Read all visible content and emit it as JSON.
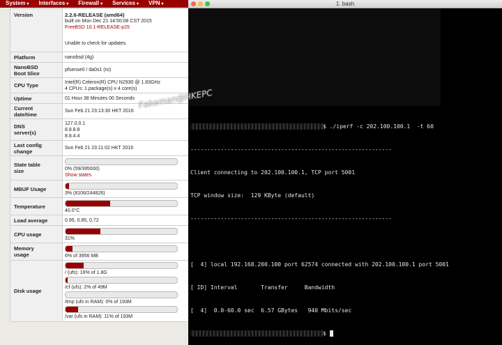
{
  "nav": {
    "items": [
      {
        "label": "System",
        "dd": "▾"
      },
      {
        "label": "Interfaces",
        "dd": "▾"
      },
      {
        "label": "Firewall",
        "dd": "▾"
      },
      {
        "label": "Services",
        "dd": "▾"
      },
      {
        "label": "VPN",
        "dd": "▾"
      }
    ]
  },
  "sysinfo": {
    "version": {
      "label": "Version",
      "line1": "2.2.6-RELEASE (amd64)",
      "line2": "built on Mon Dec 21 14:50:08 CST 2015",
      "line3": "FreeBSD 10.1-RELEASE-p25",
      "line4": "Unable to check for updates."
    },
    "platform": {
      "label": "Platform",
      "value": "nanobsd (4g)"
    },
    "bootslice": {
      "label1": "NanoBSD",
      "label2": "Boot Slice",
      "value": "pfsense0 / da0s1 (ro)"
    },
    "cpu_type": {
      "label": "CPU Type",
      "line1": "Intel(R) Celeron(R) CPU N2930 @ 1.83GHz",
      "line2": "4 CPUs: 1 package(s) x 4 core(s)"
    },
    "uptime": {
      "label": "Uptime",
      "value": "01 Hour 38 Minutes 00 Seconds"
    },
    "current": {
      "label1": "Current",
      "label2": "date/time",
      "value": "Sun Feb 21 23:13:30 HKT 2016"
    },
    "dns": {
      "label1": "DNS",
      "label2": "server(s)",
      "servers": [
        "127.0.0.1",
        "8.8.8.8",
        "8.8.4.4"
      ]
    },
    "lastconfig": {
      "label1": "Last config",
      "label2": "change",
      "value": "Sun Feb 21 23:11:02 HKT 2016"
    },
    "statetable": {
      "label1": "State table",
      "label2": "size",
      "value": "0% (59/395000)",
      "link": "Show states",
      "fraction": 0.0
    },
    "mbuf": {
      "label": "MBUF Usage",
      "value": "3% (8106/244826)",
      "fraction": 0.03
    },
    "temperature": {
      "label": "Temperature",
      "value": "40.0°C",
      "fraction": 0.4
    },
    "loadavg": {
      "label": "Load average",
      "value": "0.95, 0.85, 0.72"
    },
    "cpuusage": {
      "label": "CPU usage",
      "value": "31%",
      "fraction": 0.31
    },
    "memory": {
      "label1": "Memory",
      "label2": "usage",
      "value": "6% of 3956 MB",
      "fraction": 0.06
    },
    "disk": {
      "label": "Disk usage",
      "items": [
        {
          "text": "/ (ufs): 16% of 1.8G",
          "fraction": 0.16
        },
        {
          "text": "/cf (ufs): 2% of 49M",
          "fraction": 0.02
        },
        {
          "text": "/tmp (ufs in RAM): 0% of 193M",
          "fraction": 0.0
        },
        {
          "text": "/var (ufs in RAM): 11% of 193M",
          "fraction": 0.11
        }
      ]
    }
  },
  "terminal": {
    "title": "1. bash",
    "lines": {
      "cmd": "$ ./iperf -c 202.100.100.1  -t 60",
      "sep1": "------------------------------------------------------------",
      "client": "Client connecting to 202.100.100.1, TCP port 5001",
      "window": "TCP window size:  129 KByte (default)",
      "sep2": "------------------------------------------------------------",
      "local": "[  4] local 192.168.200.100 port 62574 connected with 202.100.100.1 port 5001",
      "header": "[ ID] Interval       Transfer     Bandwidth",
      "result": "[  4]  0.0-60.0 sec  6.57 GBytes   940 Mbits/sec",
      "prompt": "$ "
    }
  },
  "watermark": "Fakeman@HKEPC"
}
